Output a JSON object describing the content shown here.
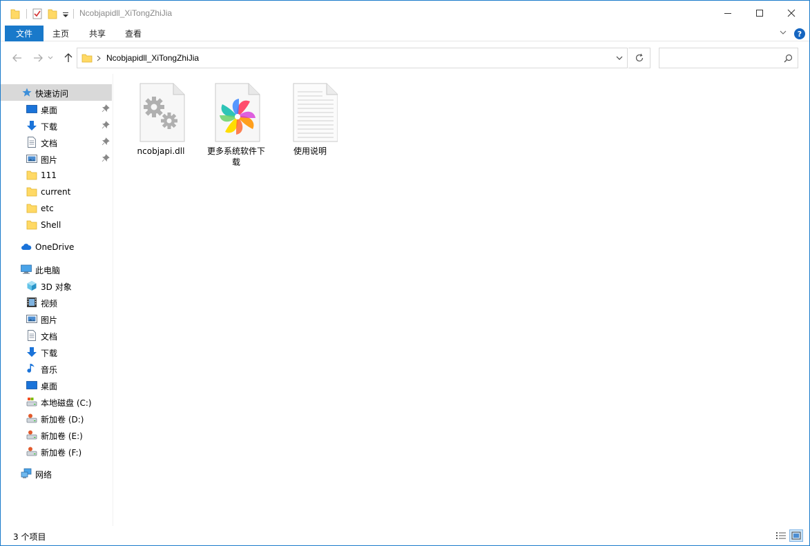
{
  "window": {
    "title": "Ncobjapidll_XiTongZhiJia"
  },
  "ribbon": {
    "tabs": [
      {
        "label": "文件"
      },
      {
        "label": "主页"
      },
      {
        "label": "共享"
      },
      {
        "label": "查看"
      }
    ],
    "help_label": "?"
  },
  "address": {
    "path": "Ncobjapidll_XiTongZhiJia",
    "search_placeholder": ""
  },
  "sidebar": {
    "items": [
      {
        "label": "快速访问",
        "icon": "star-icon"
      },
      {
        "label": "桌面",
        "icon": "desktop-icon",
        "pinned": true
      },
      {
        "label": "下载",
        "icon": "download-icon",
        "pinned": true
      },
      {
        "label": "文档",
        "icon": "document-icon",
        "pinned": true
      },
      {
        "label": "图片",
        "icon": "picture-icon",
        "pinned": true
      },
      {
        "label": "111",
        "icon": "folder-icon"
      },
      {
        "label": "current",
        "icon": "folder-icon"
      },
      {
        "label": "etc",
        "icon": "folder-icon"
      },
      {
        "label": "Shell",
        "icon": "folder-icon"
      },
      {
        "label": "OneDrive",
        "icon": "cloud-icon"
      },
      {
        "label": "此电脑",
        "icon": "computer-icon"
      },
      {
        "label": "3D 对象",
        "icon": "cube-icon"
      },
      {
        "label": "视频",
        "icon": "video-icon"
      },
      {
        "label": "图片",
        "icon": "picture-icon"
      },
      {
        "label": "文档",
        "icon": "document-icon"
      },
      {
        "label": "下载",
        "icon": "download-icon"
      },
      {
        "label": "音乐",
        "icon": "music-icon"
      },
      {
        "label": "桌面",
        "icon": "desktop-icon"
      },
      {
        "label": "本地磁盘 (C:)",
        "icon": "drive-icon"
      },
      {
        "label": "新加卷 (D:)",
        "icon": "drive-icon"
      },
      {
        "label": "新加卷 (E:)",
        "icon": "drive-icon"
      },
      {
        "label": "新加卷 (F:)",
        "icon": "drive-icon"
      },
      {
        "label": "网络",
        "icon": "network-icon"
      }
    ]
  },
  "files": [
    {
      "name": "ncobjapi.dll",
      "icon": "dll-gear-icon"
    },
    {
      "name": "更多系统软件下载",
      "icon": "pinwheel-icon"
    },
    {
      "name": "使用说明",
      "icon": "text-file-icon"
    }
  ],
  "status": {
    "item_count": "3 个项目"
  },
  "colors": {
    "accent": "#1979ca",
    "folder": "#ffd965",
    "selected_bg": "#d9d9d9"
  }
}
